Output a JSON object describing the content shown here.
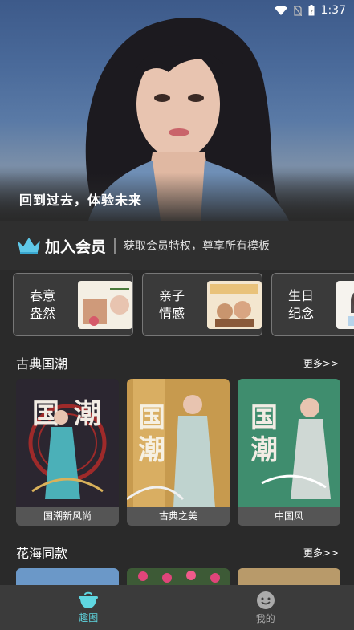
{
  "status_bar": {
    "time": "1:37"
  },
  "hero": {
    "caption": "回到过去，体验未来"
  },
  "member": {
    "title": "加入会员",
    "subtitle": "获取会员特权，尊享所有模板"
  },
  "categories": [
    {
      "label_line1": "春意",
      "label_line2": "盎然"
    },
    {
      "label_line1": "亲子",
      "label_line2": "情感"
    },
    {
      "label_line1": "生日",
      "label_line2": "纪念"
    }
  ],
  "section1": {
    "title": "古典国潮",
    "more": "更多>>",
    "tiles": [
      {
        "label": "国潮新风尚"
      },
      {
        "label": "古典之美"
      },
      {
        "label": "中国风"
      }
    ]
  },
  "section2": {
    "title": "花海同款",
    "more": "更多>>"
  },
  "nav": [
    {
      "label": "趣图"
    },
    {
      "label": "我的"
    }
  ],
  "colors": {
    "accent": "#5fd6e0",
    "background": "#2a2a2a",
    "nav_bg": "#3b3b3b"
  }
}
